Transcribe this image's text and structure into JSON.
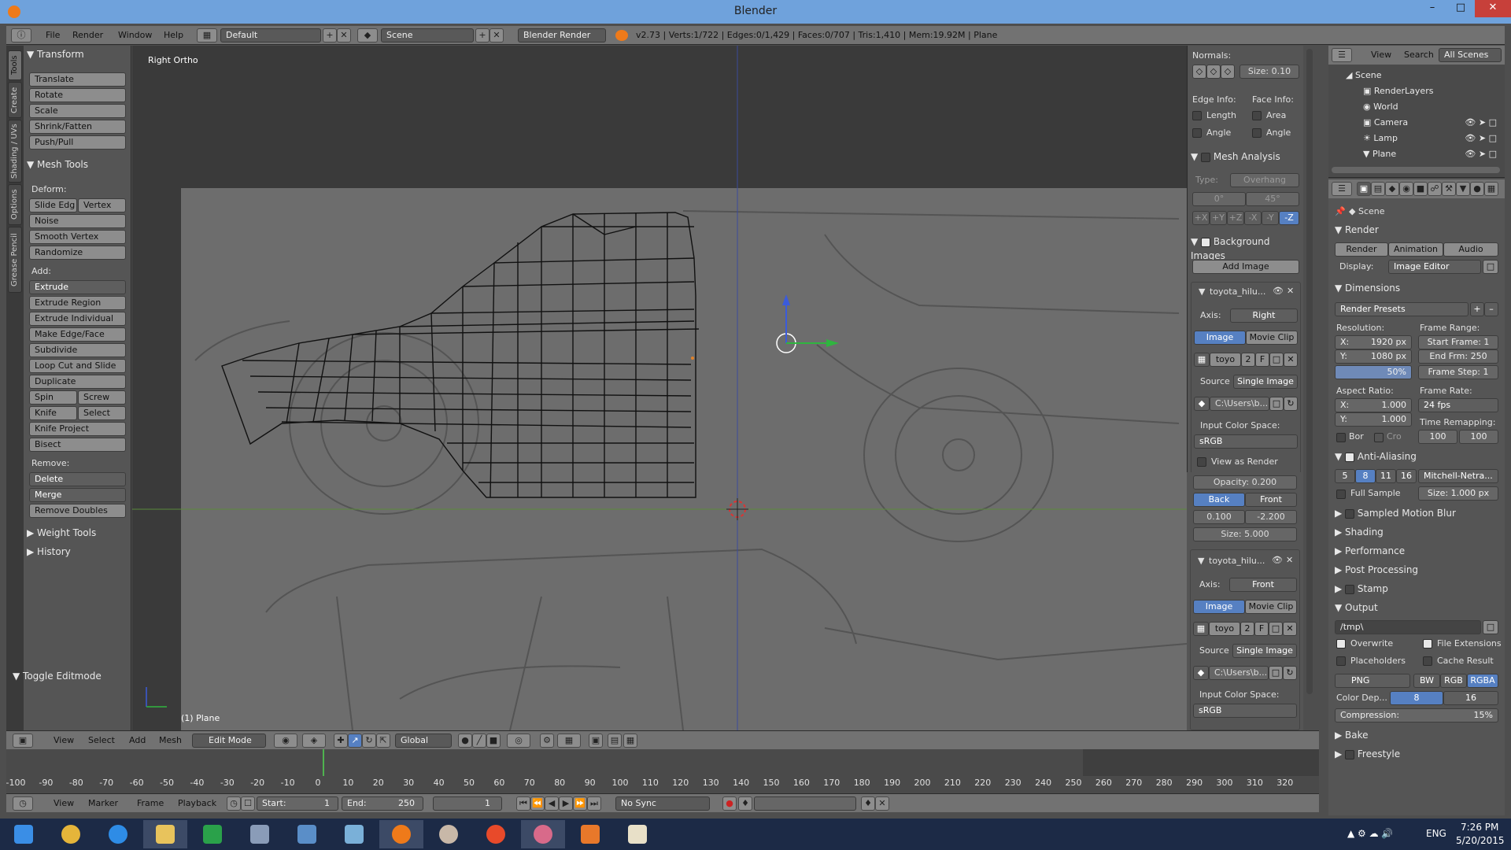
{
  "window": {
    "title": "Blender"
  },
  "info_header": {
    "menus": [
      "File",
      "Render",
      "Window",
      "Help"
    ],
    "layout": "Default",
    "scene": "Scene",
    "engine": "Blender Render",
    "stats": "v2.73 | Verts:1/722 | Edges:0/1,429 | Faces:0/707 | Tris:1,410 | Mem:19.92M | Plane"
  },
  "tool_tabs": [
    "Tools",
    "Create",
    "Shading / UVs",
    "Options",
    "Grease Pencil"
  ],
  "toolshelf": {
    "transform_header": "Transform",
    "transform": [
      "Translate",
      "Rotate",
      "Scale",
      "Shrink/Fatten",
      "Push/Pull"
    ],
    "mesh_tools_header": "Mesh Tools",
    "deform_label": "Deform:",
    "slide_edge": "Slide Edg",
    "vertex": "Vertex",
    "deform": [
      "Noise",
      "Smooth Vertex",
      "Randomize"
    ],
    "add_label": "Add:",
    "extrude": "Extrude",
    "add": [
      "Extrude Region",
      "Extrude Individual",
      "Make Edge/Face",
      "Subdivide",
      "Loop Cut and Slide",
      "Duplicate"
    ],
    "spin": "Spin",
    "screw": "Screw",
    "knife": "Knife",
    "select": "Select",
    "knife_project": "Knife Project",
    "bisect": "Bisect",
    "remove_label": "Remove:",
    "delete": "Delete",
    "merge": "Merge",
    "remove_doubles": "Remove Doubles",
    "weight_tools": "Weight Tools",
    "history": "History",
    "toggle_editmode": "Toggle Editmode"
  },
  "viewport": {
    "view_name": "Right Ortho",
    "object_label": "(1) Plane"
  },
  "npanel": {
    "normals_label": "Normals:",
    "size_label": "Size:",
    "size_value": "0.10",
    "edge_info": "Edge Info:",
    "face_info": "Face Info:",
    "length": "Length",
    "area": "Area",
    "angle": "Angle",
    "angle2": "Angle",
    "mesh_analysis": "Mesh Analysis",
    "type_label": "Type:",
    "type_value": "Overhang",
    "min_angle": "0°",
    "max_angle": "45°",
    "axes": [
      "+X",
      "+Y",
      "+Z",
      "-X",
      "-Y",
      "-Z"
    ],
    "background_images": "Background Images",
    "add_image": "Add Image",
    "bg1": {
      "name": "toyota_hilu...",
      "axis_label": "Axis:",
      "axis": "Right",
      "image": "Image",
      "movie_clip": "Movie Clip",
      "img_name": "toyo",
      "users": "2",
      "fake": "F",
      "source_label": "Source",
      "source": "Single Image",
      "path": "C:\\Users\\b...",
      "ics_label": "Input Color Space:",
      "ics": "sRGB",
      "view_as_render": "View as Render",
      "opacity_label": "Opacity:",
      "opacity": "0.200",
      "back": "Back",
      "front": "Front",
      "offx": "0.100",
      "offy": "-2.200",
      "size_label": "Size:",
      "size": "5.000"
    },
    "bg2": {
      "name": "toyota_hilu...",
      "axis_label": "Axis:",
      "axis": "Front",
      "image": "Image",
      "movie_clip": "Movie Clip",
      "img_name": "toyo",
      "users": "2",
      "fake": "F",
      "source_label": "Source",
      "source": "Single Image",
      "path": "C:\\Users\\b...",
      "ics_label": "Input Color Space:",
      "ics": "sRGB"
    }
  },
  "outliner": {
    "view": "View",
    "search": "Search",
    "filter": "All Scenes",
    "rows": [
      "Scene",
      "RenderLayers",
      "World",
      "Camera",
      "Lamp",
      "Plane"
    ]
  },
  "properties": {
    "scene": "Scene",
    "render_header": "Render",
    "render": "Render",
    "animation": "Animation",
    "audio": "Audio",
    "display_label": "Display:",
    "display": "Image Editor",
    "dimensions": "Dimensions",
    "render_presets": "Render Presets",
    "resolution_label": "Resolution:",
    "res_x": "X:",
    "res_x_val": "1920 px",
    "res_y": "Y:",
    "res_y_val": "1080 px",
    "res_pct": "50%",
    "frame_range_label": "Frame Range:",
    "start_frame": "Start Frame: 1",
    "end_frame": "End Frm: 250",
    "frame_step": "Frame Step: 1",
    "aspect_label": "Aspect Ratio:",
    "asp_x": "X:",
    "asp_x_val": "1.000",
    "asp_y": "Y:",
    "asp_y_val": "1.000",
    "frame_rate_label": "Frame Rate:",
    "fps": "24 fps",
    "time_remap_label": "Time Remapping:",
    "remap_old": "100",
    "remap_new": "100",
    "bor": "Bor",
    "cro": "Cro",
    "anti_aliasing": "Anti-Aliasing",
    "aa_samples": [
      "5",
      "8",
      "11",
      "16"
    ],
    "filter": "Mitchell-Netra...",
    "full_sample": "Full Sample",
    "aa_size": "Size: 1.000 px",
    "sampled_motion_blur": "Sampled Motion Blur",
    "shading": "Shading",
    "performance": "Performance",
    "post_processing": "Post Processing",
    "stamp": "Stamp",
    "output": "Output",
    "output_path": "/tmp\\",
    "overwrite": "Overwrite",
    "file_extensions": "File Extensions",
    "placeholders": "Placeholders",
    "cache_result": "Cache Result",
    "format": "PNG",
    "bw": "BW",
    "rgb": "RGB",
    "rgba": "RGBA",
    "color_depth_label": "Color Dep...",
    "depth8": "8",
    "depth16": "16",
    "compression": "Compression:",
    "compression_val": "15%",
    "bake": "Bake",
    "freestyle": "Freestyle"
  },
  "view_header": {
    "menus": [
      "View",
      "Select",
      "Add",
      "Mesh"
    ],
    "mode": "Edit Mode",
    "orientation": "Global"
  },
  "timeline": {
    "ticks": [
      "-100",
      "-90",
      "-80",
      "-70",
      "-60",
      "-50",
      "-40",
      "-30",
      "-20",
      "-10",
      "0",
      "10",
      "20",
      "30",
      "40",
      "50",
      "60",
      "70",
      "80",
      "90",
      "100",
      "110",
      "120",
      "130",
      "140",
      "150",
      "160",
      "170",
      "180",
      "190",
      "200",
      "210",
      "220",
      "230",
      "240",
      "250",
      "260",
      "270",
      "280",
      "290",
      "300",
      "310",
      "320"
    ],
    "menus": [
      "View",
      "Marker",
      "Frame",
      "Playback"
    ],
    "start": "Start:",
    "start_val": "1",
    "end": "End:",
    "end_val": "250",
    "current": "1",
    "sync": "No Sync"
  },
  "taskbar": {
    "lang": "ENG",
    "time": "7:26 PM",
    "date": "5/20/2015"
  }
}
